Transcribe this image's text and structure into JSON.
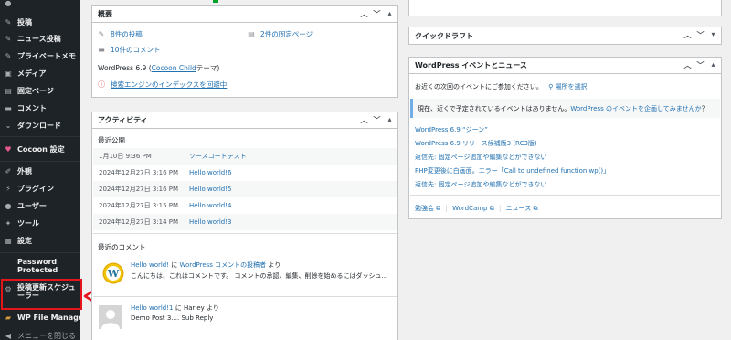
{
  "sidebar": {
    "items": [
      {
        "label": "投稿",
        "icon": "pin-icon"
      },
      {
        "label": "ニュース投稿",
        "icon": "pin-icon"
      },
      {
        "label": "プライベートメモ",
        "icon": "pin-icon"
      },
      {
        "label": "メディア",
        "icon": "media-icon"
      },
      {
        "label": "固定ページ",
        "icon": "page-icon"
      },
      {
        "label": "コメント",
        "icon": "comment-icon"
      },
      {
        "label": "ダウンロード",
        "icon": "download-icon"
      },
      {
        "label": "Cocoon 設定",
        "icon": "heart-icon"
      },
      {
        "label": "外観",
        "icon": "brush-icon"
      },
      {
        "label": "プラグイン",
        "icon": "plugin-icon"
      },
      {
        "label": "ユーザー",
        "icon": "user-icon"
      },
      {
        "label": "ツール",
        "icon": "wrench-icon"
      },
      {
        "label": "設定",
        "icon": "settings-icon"
      },
      {
        "label_line1": "Password",
        "label_line2": "Protected",
        "icon": ""
      },
      {
        "label_line1": "投稿更新スケジュ",
        "label_line2": "ーラー",
        "icon": "gear-icon"
      },
      {
        "label": "WP File Manager",
        "icon": "folder-icon"
      },
      {
        "label": "メニューを閉じる",
        "icon": "collapse-icon"
      }
    ]
  },
  "overview": {
    "title": "概要",
    "posts": "8件の投稿",
    "pages": "2件の固定ページ",
    "comments": "10件のコメント",
    "wp_version": "WordPress 6.9 (",
    "theme_link": "Cocoon Child",
    "theme_suffix": " テーマ)",
    "warning": "検索エンジンのインデックスを回避中"
  },
  "activity": {
    "title": "アクティビティ",
    "recent_heading": "最近公開",
    "rows": [
      {
        "date": "1月10日 9:36 PM",
        "title": "ソースコードテスト"
      },
      {
        "date": "2024年12月27日 3:16 PM",
        "title": "Hello world!6"
      },
      {
        "date": "2024年12月27日 3:16 PM",
        "title": "Hello world!5"
      },
      {
        "date": "2024年12月27日 3:15 PM",
        "title": "Hello world!4"
      },
      {
        "date": "2024年12月27日 3:14 PM",
        "title": "Hello world!3"
      }
    ],
    "comments_heading": "最近のコメント",
    "comments": [
      {
        "post": "Hello world!",
        "mid": " に ",
        "author": "WordPress コメントの投稿者",
        "suffix": " より",
        "excerpt": "こんにちは、これはコメントです。 コメントの承認、編集、削除を始めるにはダッシュ..."
      },
      {
        "post": "Hello world!1",
        "mid": " に ",
        "author": "Harley",
        "suffix": " より",
        "excerpt": "Demo Post 3.... Sub Reply"
      }
    ]
  },
  "quick_draft": {
    "title": "クイックドラフト"
  },
  "events": {
    "title": "WordPress イベントとニュース",
    "nearby": "お近くの次回のイベントにご参加ください。",
    "location": "場所を選択",
    "notice_prefix": "現在、近くで予定されているイベントはありません。",
    "notice_link": "WordPress のイベントを企画してみませんか",
    "notice_suffix": "？",
    "news": [
      "WordPress 6.9 “ジーン”",
      "WordPress 6.9 リリース候補版3 (RC3版)",
      "返信先: 固定ページ追加や編集などができない",
      "PHP変更後に白画面。エラー「Call to undefined function wp()」",
      "返信先: 固定ページ追加や編集などができない"
    ],
    "footer": [
      "勉強会",
      "WordCamp",
      "ニュース"
    ]
  }
}
